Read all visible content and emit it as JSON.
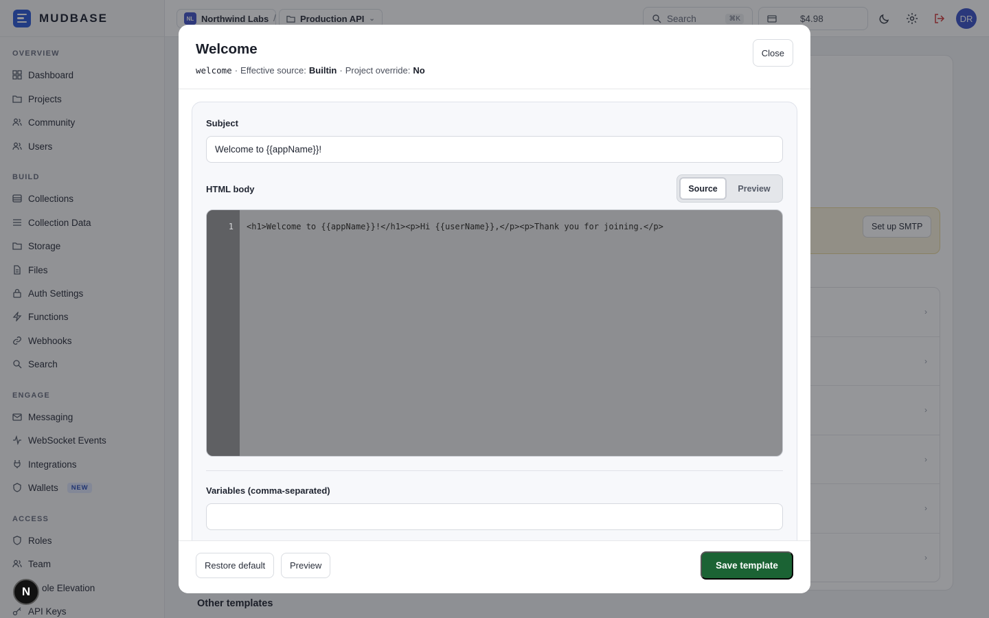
{
  "app": {
    "brand": "MUDBASE"
  },
  "sidebar": {
    "sections": [
      {
        "title": "OVERVIEW",
        "items": [
          {
            "label": "Dashboard",
            "icon": "dashboard-icon"
          },
          {
            "label": "Projects",
            "icon": "folder-icon"
          },
          {
            "label": "Community",
            "icon": "community-icon"
          },
          {
            "label": "Users",
            "icon": "users-icon"
          }
        ]
      },
      {
        "title": "BUILD",
        "items": [
          {
            "label": "Collections",
            "icon": "database-icon"
          },
          {
            "label": "Collection Data",
            "icon": "list-icon"
          },
          {
            "label": "Storage",
            "icon": "folder-icon"
          },
          {
            "label": "Files",
            "icon": "file-icon"
          },
          {
            "label": "Auth Settings",
            "icon": "lock-icon"
          },
          {
            "label": "Functions",
            "icon": "bolt-icon"
          },
          {
            "label": "Webhooks",
            "icon": "link-icon"
          },
          {
            "label": "Search",
            "icon": "search-icon"
          }
        ]
      },
      {
        "title": "ENGAGE",
        "items": [
          {
            "label": "Messaging",
            "icon": "mail-icon"
          },
          {
            "label": "WebSocket Events",
            "icon": "activity-icon"
          },
          {
            "label": "Integrations",
            "icon": "plug-icon"
          },
          {
            "label": "Wallets",
            "icon": "wallet-icon",
            "badge": "NEW"
          }
        ]
      },
      {
        "title": "ACCESS",
        "items": [
          {
            "label": "Roles",
            "icon": "shield-icon"
          },
          {
            "label": "Team",
            "icon": "team-icon"
          },
          {
            "label": "ole Elevation",
            "icon": "elevation-icon"
          },
          {
            "label": "API Keys",
            "icon": "key-icon"
          }
        ]
      }
    ]
  },
  "topbar": {
    "org_initials": "NL",
    "org_name": "Northwind Labs",
    "separator": "/",
    "project_name": "Production API",
    "search_placeholder": "Search",
    "search_shortcut": "⌘K",
    "credits": "$4.98",
    "avatar_initials": "DR"
  },
  "background": {
    "smtp_button": "Set up SMTP",
    "other_templates": "Other templates",
    "toast_letter": "N"
  },
  "modal": {
    "title": "Welcome",
    "template_key": "welcome",
    "sep1": "·",
    "source_label": "Effective source:",
    "source_value": "Builtin",
    "sep2": "·",
    "override_label": "Project override:",
    "override_value": "No",
    "close_label": "Close",
    "subject_label": "Subject",
    "subject_value": "Welcome to {{appName}}!",
    "html_body_label": "HTML body",
    "tab_source": "Source",
    "tab_preview": "Preview",
    "active_tab": "Source",
    "editor": {
      "line_number": "1",
      "code": "<h1>Welcome to {{appName}}!</h1><p>Hi {{userName}},</p><p>Thank you for joining.</p>"
    },
    "variables_label": "Variables (comma-separated)",
    "variables_value": "",
    "footer": {
      "restore_label": "Restore default",
      "preview_label": "Preview",
      "save_label": "Save template"
    }
  },
  "colors": {
    "primary": "#1b6334",
    "brand": "#2e5bd8",
    "overlay": "rgba(20,22,28,0.45)"
  }
}
